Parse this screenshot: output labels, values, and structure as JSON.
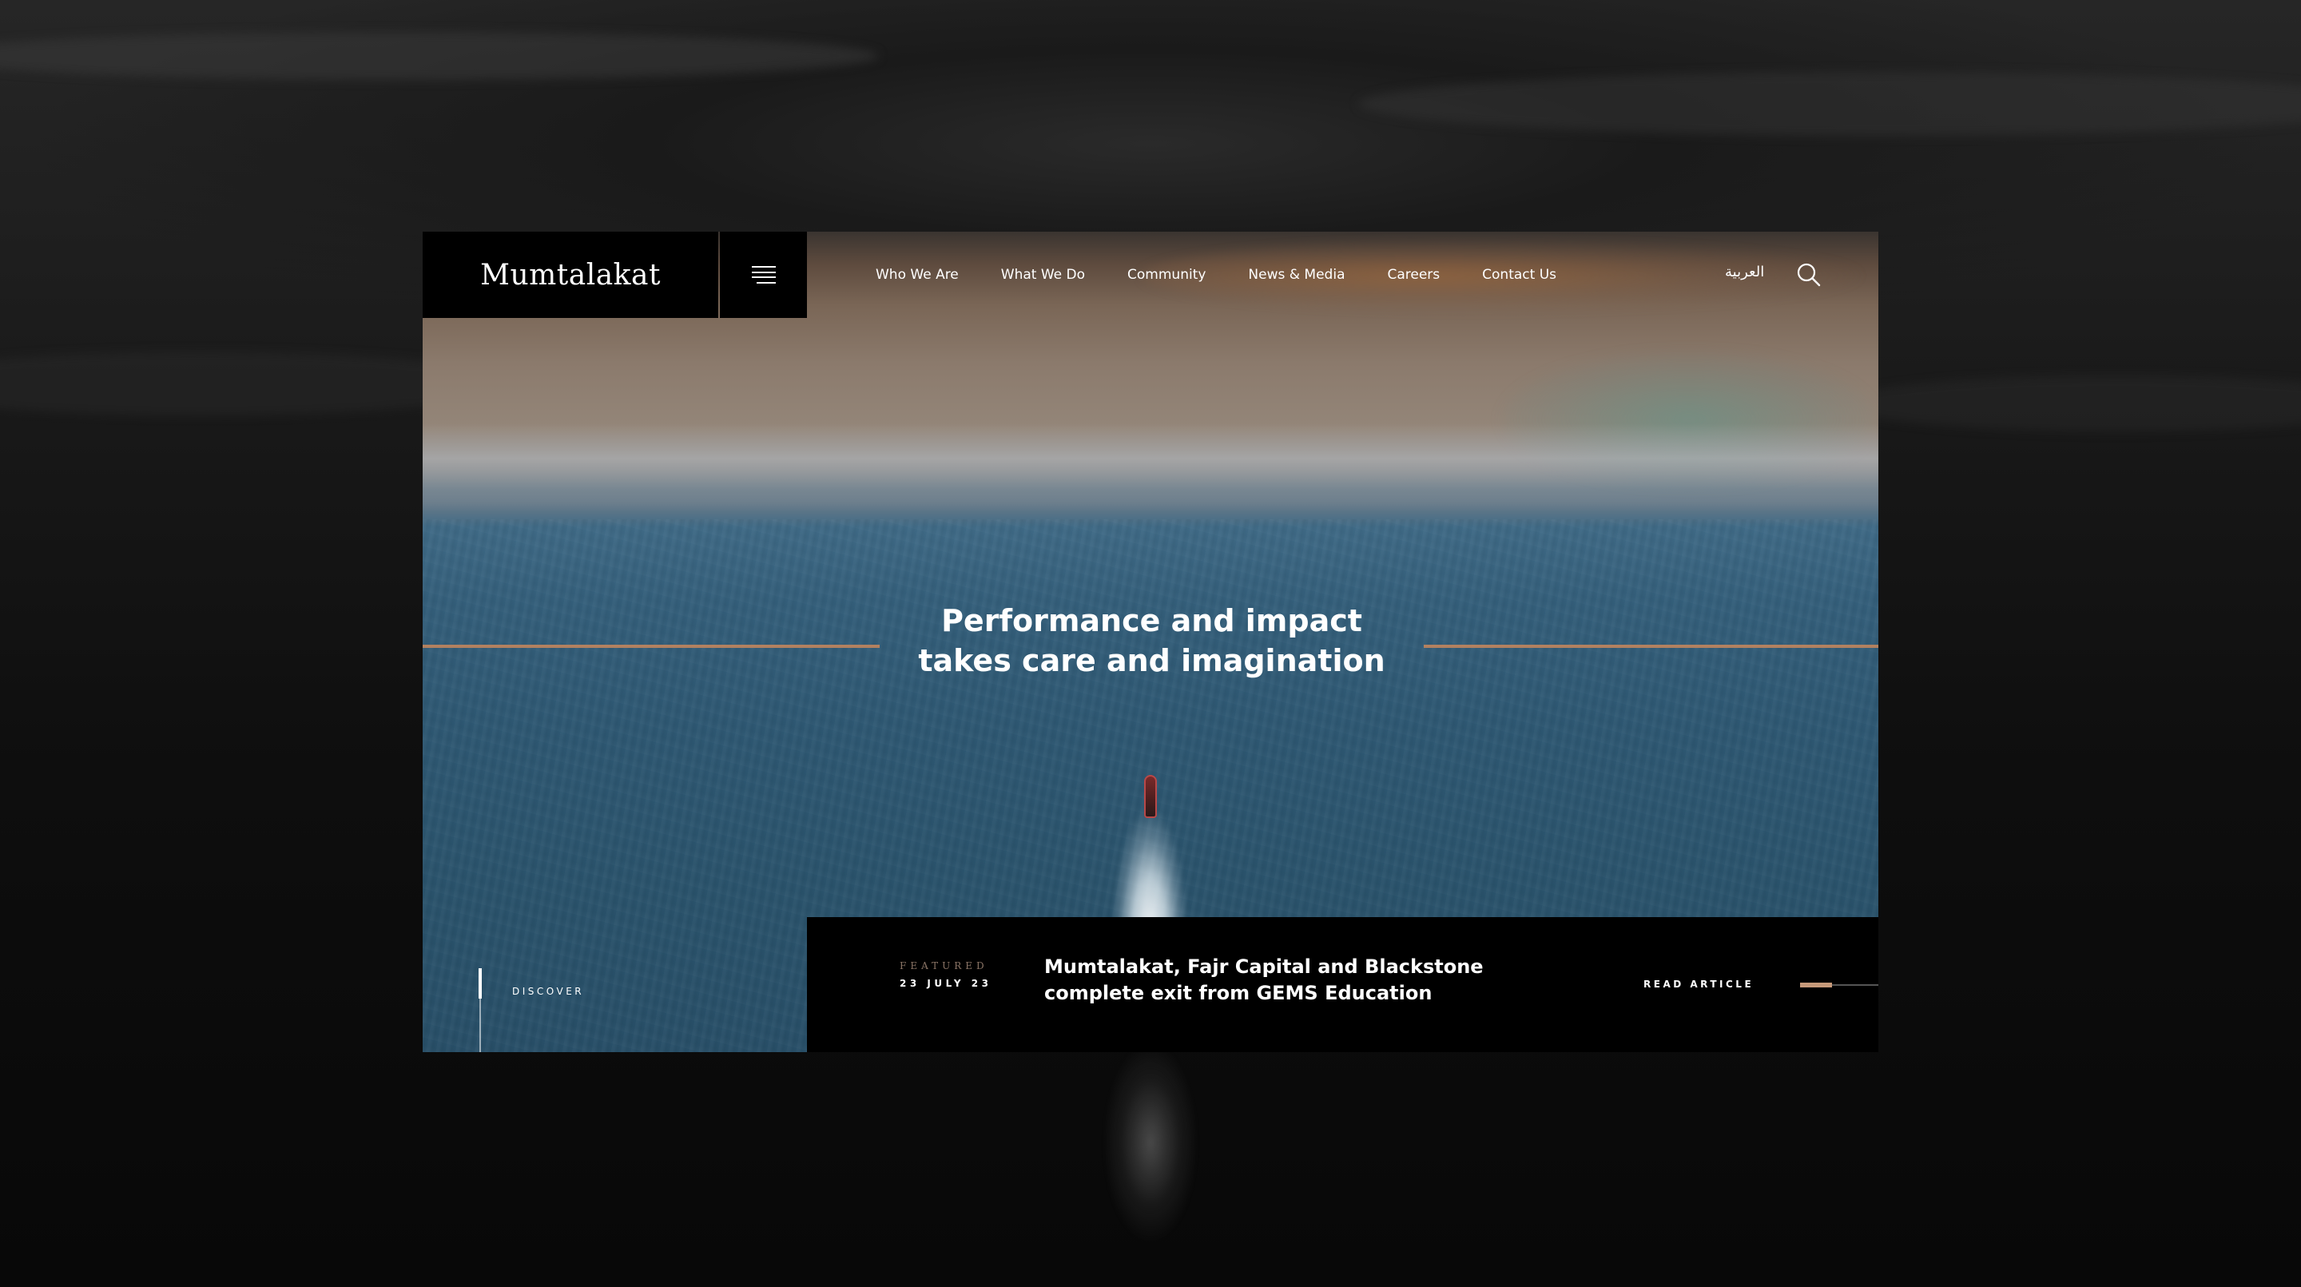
{
  "brand": {
    "logo_text": "Mumtalakat"
  },
  "colors": {
    "accent": "#b28160",
    "header_bg": "#000000",
    "text": "#ffffff"
  },
  "nav": {
    "items": [
      {
        "label": "Who We Are"
      },
      {
        "label": "What We Do"
      },
      {
        "label": "Community"
      },
      {
        "label": "News & Media"
      },
      {
        "label": "Careers"
      },
      {
        "label": "Contact Us"
      }
    ],
    "language_label": "العربية",
    "menu_icon": "hamburger-menu-icon",
    "search_icon": "search-icon"
  },
  "hero": {
    "headline_line1": "Performance and impact",
    "headline_line2": "takes care and imagination"
  },
  "discover": {
    "label": "DISCOVER"
  },
  "featured": {
    "label": "FEATURED",
    "date": "23 JULY 23",
    "title_line1": "Mumtalakat, Fajr Capital and Blackstone",
    "title_line2": "complete exit from GEMS Education",
    "cta_label": "READ ARTICLE"
  }
}
